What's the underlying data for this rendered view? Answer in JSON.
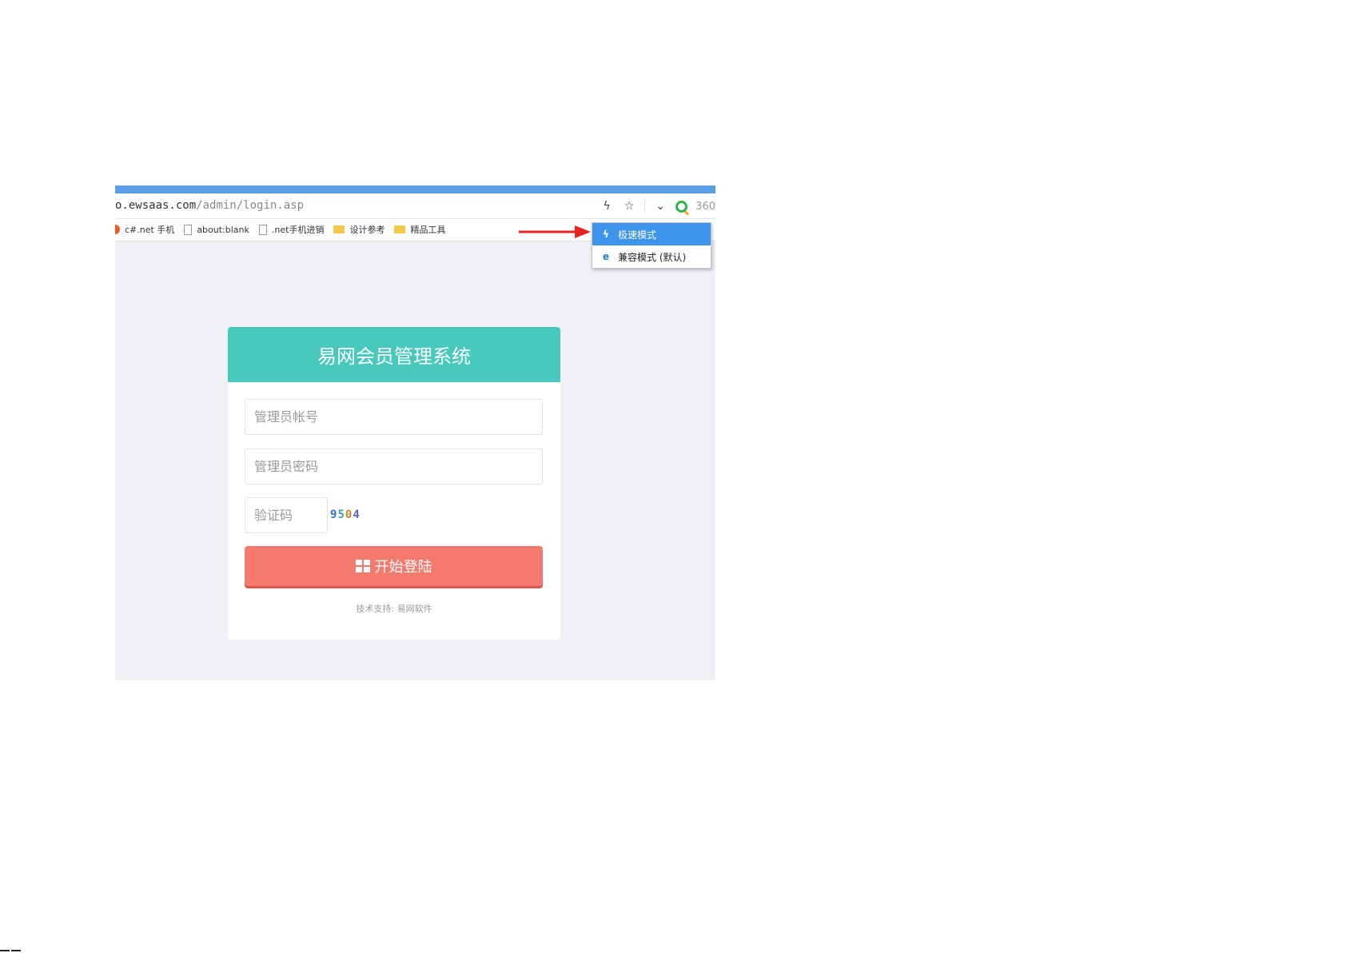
{
  "browser": {
    "url_host": "o.ewsaas.com",
    "url_path": "/admin/login.asp",
    "browser_name": "360",
    "icons": [
      "lightning-icon",
      "star-icon",
      "chevron-down-icon",
      "browser-360-logo"
    ],
    "bookmarks": [
      {
        "label": "c#.net 手机",
        "icon": "red-dot-icon"
      },
      {
        "label": "about:blank",
        "icon": "page-icon"
      },
      {
        "label": ".net手机进销",
        "icon": "page-icon"
      },
      {
        "label": "设计参考",
        "icon": "folder-icon"
      },
      {
        "label": "精品工具",
        "icon": "folder-icon"
      }
    ]
  },
  "annotation": {
    "arrow_color": "#e8221e"
  },
  "mode_menu": {
    "items": [
      {
        "label": "极速模式",
        "icon": "lightning-icon",
        "active": true
      },
      {
        "label": "兼容模式 (默认)",
        "icon": "ie-icon",
        "active": false
      }
    ],
    "active_color": "#3c95ea"
  },
  "login": {
    "title": "易网会员管理系统",
    "username_placeholder": "管理员帐号",
    "password_placeholder": "管理员密码",
    "captcha_placeholder": "验证码",
    "captcha_code": [
      "9",
      "5",
      "0",
      "4"
    ],
    "submit_label": "开始登陆",
    "submit_icon": "windows-icon",
    "support_text": "技术支持: 易网软件",
    "header_color": "#47c9be",
    "button_color": "#f47a6e"
  }
}
